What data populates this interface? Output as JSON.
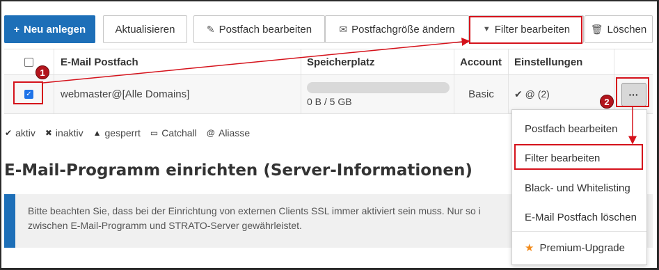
{
  "toolbar": {
    "new": "Neu anlegen",
    "refresh": "Aktualisieren",
    "edit_mailbox": "Postfach bearbeiten",
    "change_size": "Postfachgröße ändern",
    "edit_filter": "Filter bearbeiten",
    "delete": "Löschen"
  },
  "table": {
    "headers": [
      "E-Mail Postfach",
      "Speicherplatz",
      "Account",
      "Einstellungen"
    ],
    "row": {
      "checked": true,
      "mailbox": "webmaster@[Alle Domains]",
      "usage_fraction": 0,
      "storage": "0 B / 5 GB",
      "account": "Basic",
      "settings": "✔ @ (2)",
      "more": "···"
    }
  },
  "legend": {
    "active": "aktiv",
    "inactive": "inaktiv",
    "locked": "gesperrt",
    "catchall": "Catchall",
    "aliases": "Aliasse"
  },
  "section_title": "E-Mail-Programm einrichten (Server-Informationen)",
  "info_text": "Bitte beachten Sie, dass bei der Einrichtung von externen Clients SSL immer aktiviert sein muss. Nur so i\nzwischen E-Mail-Programm und STRATO-Server gewährleistet.",
  "menu": {
    "items": [
      "Postfach bearbeiten",
      "Filter bearbeiten",
      "Black- und Whitelisting",
      "E-Mail Postfach löschen",
      "Premium-Upgrade"
    ]
  },
  "annotations": {
    "badge1": "1",
    "badge2": "2"
  },
  "colors": {
    "primary": "#1d6fb8",
    "highlight": "#d5121b",
    "star": "#f28b1c"
  }
}
